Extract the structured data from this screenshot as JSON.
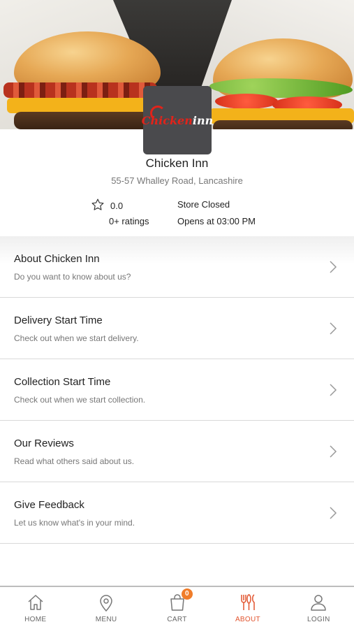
{
  "store": {
    "name": "Chicken Inn",
    "address": "55-57 Whalley Road, Lancashire",
    "logo_text_a": "Chicken",
    "logo_text_b": "inn",
    "rating_value": "0.0",
    "rating_count": "0+ ratings",
    "status": "Store Closed",
    "opens_at": "Opens at 03:00 PM"
  },
  "menu": {
    "items": [
      {
        "title": "About Chicken Inn",
        "subtitle": "Do you want to know about us?"
      },
      {
        "title": "Delivery Start Time",
        "subtitle": "Check out when we start delivery."
      },
      {
        "title": "Collection Start Time",
        "subtitle": "Check out when we start collection."
      },
      {
        "title": "Our Reviews",
        "subtitle": "Read what others said about us."
      },
      {
        "title": "Give Feedback",
        "subtitle": "Let us know what's in your mind."
      }
    ]
  },
  "tabbar": {
    "home": "HOME",
    "menu": "MENU",
    "cart": "CART",
    "cart_count": "0",
    "about": "ABOUT",
    "login": "LOGIN",
    "active": "about"
  },
  "colors": {
    "accent": "#e2542e",
    "badge": "#f07d2a",
    "logo_bg": "#4a4a4d"
  },
  "icons": [
    "star-icon",
    "chevron-right-icon",
    "home-icon",
    "map-pin-icon",
    "bag-icon",
    "cutlery-icon",
    "user-icon"
  ]
}
